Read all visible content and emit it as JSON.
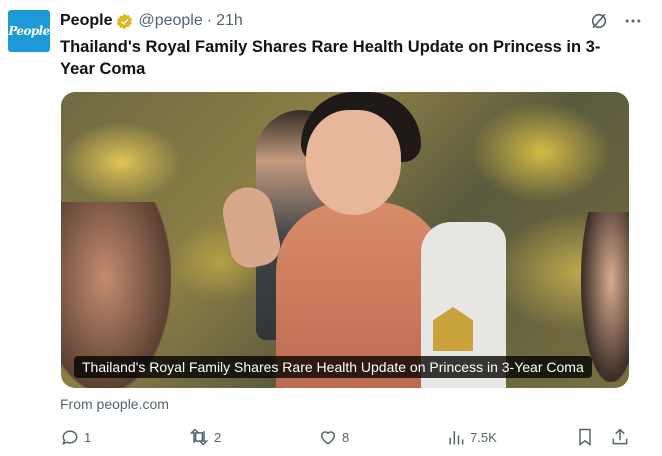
{
  "post": {
    "author_name": "People",
    "avatar_text": "People",
    "handle": "@people",
    "separator": "·",
    "time": "21h",
    "title": "Thailand's Royal Family Shares Rare Health Update on Princess in 3-Year Coma",
    "media_caption": "Thailand's Royal Family Shares Rare Health Update on Princess in 3-Year Coma",
    "source": "From people.com"
  },
  "actions": {
    "replies": "1",
    "reposts": "2",
    "likes": "8",
    "views": "7.5K"
  },
  "colors": {
    "verified": "#e2b719",
    "muted": "#536471",
    "avatar_bg": "#1b9ad6"
  },
  "icons": {
    "verified": "verified-badge-icon",
    "grok": "grok-icon",
    "more": "more-icon",
    "reply": "reply-icon",
    "repost": "repost-icon",
    "like": "like-icon",
    "views": "views-icon",
    "bookmark": "bookmark-icon",
    "share": "share-icon"
  }
}
